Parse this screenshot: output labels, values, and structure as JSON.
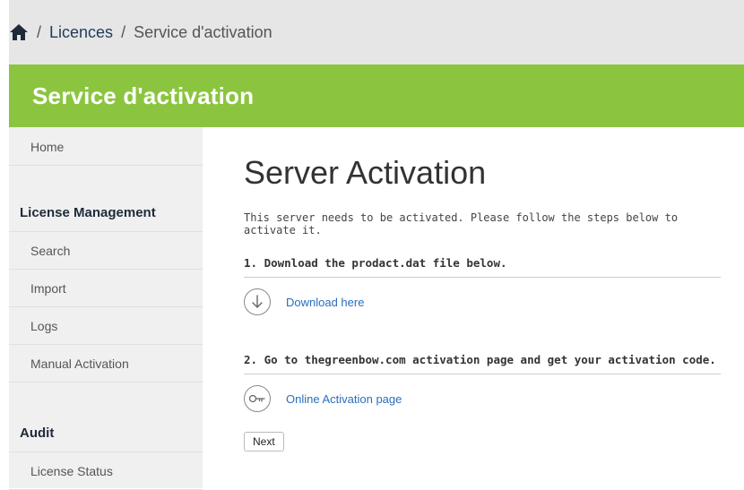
{
  "breadcrumb": {
    "separator": "/",
    "items": [
      "Licences",
      "Service d'activation"
    ]
  },
  "banner": {
    "title": "Service d'activation"
  },
  "sidebar": {
    "home": "Home",
    "sections": [
      {
        "heading": "License Management",
        "items": [
          "Search",
          "Import",
          "Logs",
          "Manual Activation"
        ]
      },
      {
        "heading": "Audit",
        "items": [
          "License Status"
        ]
      }
    ]
  },
  "main": {
    "title": "Server Activation",
    "intro": "This server needs to be activated. Please follow the steps below to activate it.",
    "steps": [
      {
        "title": "1. Download the prodact.dat file below.",
        "link": "Download here",
        "icon": "download-icon"
      },
      {
        "title": "2. Go to thegreenbow.com activation page and get your activation code.",
        "link": "Online Activation page",
        "icon": "key-icon"
      }
    ],
    "next_label": "Next"
  },
  "colors": {
    "banner": "#8bc53f",
    "link": "#2a6ebb",
    "breadcrumb_bg": "#e6e6e6",
    "sidebar_bg": "#f0f0f0"
  }
}
